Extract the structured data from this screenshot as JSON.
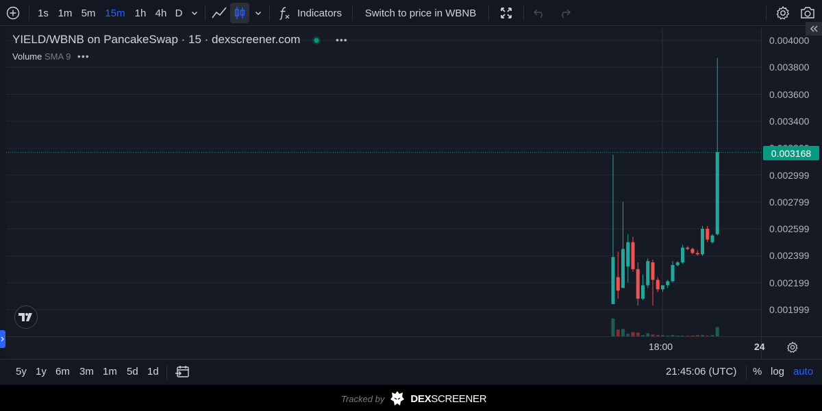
{
  "toolbar": {
    "intervals": [
      "1s",
      "1m",
      "5m",
      "15m",
      "1h",
      "4h",
      "D"
    ],
    "active_interval": "15m",
    "indicators_label": "Indicators",
    "switch_label": "Switch to price in WBNB"
  },
  "legend": {
    "title": "YIELD/WBNB on PancakeSwap · 15 · dexscreener.com",
    "volume_label": "Volume",
    "volume_sma": "SMA 9",
    "more_dots": "•••"
  },
  "price_axis": {
    "ticks": [
      "0.004000",
      "0.003800",
      "0.003600",
      "0.003400",
      "0.003200",
      "0.002999",
      "0.002799",
      "0.002599",
      "0.002399",
      "0.002199",
      "0.001999"
    ],
    "current_price": "0.003168"
  },
  "time_axis": {
    "ticks": [
      "18:00",
      "24"
    ]
  },
  "chart_data": {
    "type": "candlestick",
    "series_colors": {
      "up": "#26a69a",
      "down": "#ef5350"
    },
    "ylim": [
      0.0019,
      0.00405
    ],
    "candles": [
      {
        "o": 0.00204,
        "h": 0.00315,
        "l": 0.00204,
        "c": 0.00239
      },
      {
        "o": 0.00224,
        "h": 0.00243,
        "l": 0.00208,
        "c": 0.00214
      },
      {
        "o": 0.00216,
        "h": 0.0028,
        "l": 0.00216,
        "c": 0.00245
      },
      {
        "o": 0.00232,
        "h": 0.00256,
        "l": 0.0022,
        "c": 0.0025
      },
      {
        "o": 0.0025,
        "h": 0.00254,
        "l": 0.00228,
        "c": 0.0023
      },
      {
        "o": 0.0023,
        "h": 0.00235,
        "l": 0.00203,
        "c": 0.00208
      },
      {
        "o": 0.00208,
        "h": 0.00226,
        "l": 0.00207,
        "c": 0.00218
      },
      {
        "o": 0.00218,
        "h": 0.00238,
        "l": 0.00216,
        "c": 0.00236
      },
      {
        "o": 0.00235,
        "h": 0.00237,
        "l": 0.00203,
        "c": 0.00222
      },
      {
        "o": 0.00222,
        "h": 0.00224,
        "l": 0.00213,
        "c": 0.00215
      },
      {
        "o": 0.00215,
        "h": 0.00217,
        "l": 0.00213,
        "c": 0.00218
      },
      {
        "o": 0.00218,
        "h": 0.00222,
        "l": 0.00216,
        "c": 0.00221
      },
      {
        "o": 0.00221,
        "h": 0.00236,
        "l": 0.0022,
        "c": 0.00233
      },
      {
        "o": 0.00233,
        "h": 0.00236,
        "l": 0.00232,
        "c": 0.00235
      },
      {
        "o": 0.00235,
        "h": 0.00248,
        "l": 0.00234,
        "c": 0.00246
      },
      {
        "o": 0.00246,
        "h": 0.00247,
        "l": 0.00244,
        "c": 0.00245
      },
      {
        "o": 0.00245,
        "h": 0.00246,
        "l": 0.00241,
        "c": 0.00242
      },
      {
        "o": 0.00242,
        "h": 0.00244,
        "l": 0.0024,
        "c": 0.00241
      },
      {
        "o": 0.00241,
        "h": 0.00262,
        "l": 0.0024,
        "c": 0.0026
      },
      {
        "o": 0.0026,
        "h": 0.00262,
        "l": 0.0025,
        "c": 0.00252
      },
      {
        "o": 0.0025,
        "h": 0.00256,
        "l": 0.00249,
        "c": 0.00255
      },
      {
        "o": 0.00256,
        "h": 0.00387,
        "l": 0.00255,
        "c": 0.00317
      }
    ],
    "volumes": [
      0.29,
      0.11,
      0.12,
      0.04,
      0.07,
      0.06,
      0.02,
      0.05,
      0.03,
      0.02,
      0.02,
      0.01,
      0.02,
      0.01,
      0.01,
      0.01,
      0.01,
      0.02,
      0.02,
      0.01,
      0.02,
      0.15
    ]
  },
  "bottom": {
    "ranges": [
      "5y",
      "1y",
      "6m",
      "3m",
      "1m",
      "5d",
      "1d"
    ],
    "clock": "21:45:06 (UTC)",
    "pct": "%",
    "log": "log",
    "auto": "auto"
  },
  "footer": {
    "tracked_by": "Tracked by",
    "brand_bold": "DEX",
    "brand_rest": "SCREENER"
  }
}
